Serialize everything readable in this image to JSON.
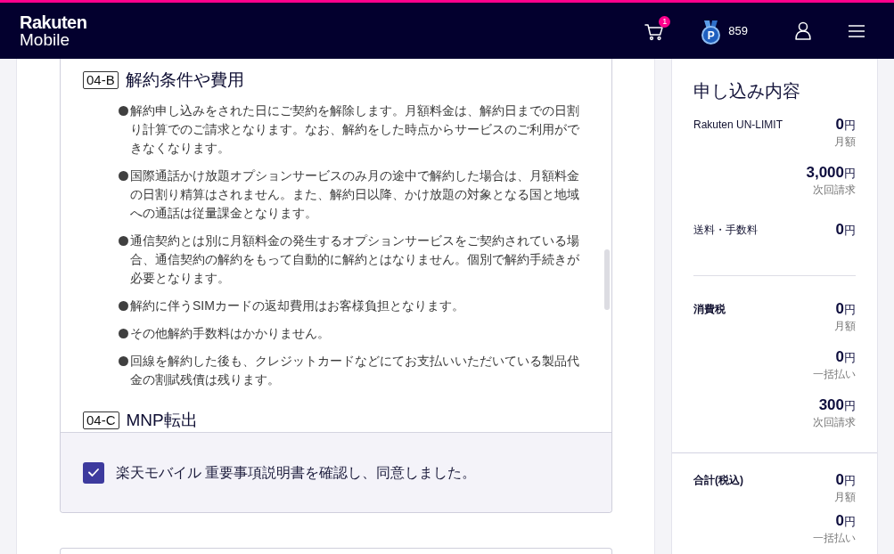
{
  "header": {
    "logo": {
      "line_1": "Rakuten",
      "line_2": "Mobile"
    },
    "cart": {
      "badge": "1"
    },
    "points": {
      "badge_letter": "P",
      "balance": "859"
    }
  },
  "terms": {
    "sections": [
      {
        "code": "04-B",
        "title": "解約条件や費用",
        "bullets": [
          "解約申し込みをされた日にご契約を解除します。月額料金は、解約日までの日割り計算でのご請求となります。なお、解約をした時点からサービスのご利用ができなくなります。",
          "国際通話かけ放題オプションサービスのみ月の途中で解約した場合は、月額料金の日割り精算はされません。また、解約日以降、かけ放題の対象となる国と地域への通話は従量課金となります。",
          "通信契約とは別に月額料金の発生するオプションサービスをご契約されている場合、通信契約の解約をもって自動的に解約とはなりません。個別で解約手続きが必要となります。",
          "解約に伴うSIMカードの返却費用はお客様負担となります。",
          "その他解約手数料はかかりません。",
          "回線を解約した後も、クレジットカードなどにてお支払いいただいている製品代金の割賦残債は残ります。"
        ]
      },
      {
        "code": "04-C",
        "title": "MNP転出"
      }
    ]
  },
  "agreement": {
    "checked": true,
    "label": "楽天モバイル 重要事項説明書を確認し、同意しました。"
  },
  "summary": {
    "sections": [
      {
        "title": "申し込み内容",
        "groups": [
          {
            "rows": [
              {
                "label": "Rakuten UN-LIMIT",
                "emphasized": false,
                "amounts": [
                  {
                    "price": "**0**円",
                    "note": "月額"
                  },
                  {
                    "price": "**3,000**円",
                    "note": "次回請求"
                  }
                ]
              },
              {
                "label": "送料・手数料",
                "emphasized": false,
                "amounts": [
                  {
                    "price": "**0**円"
                  }
                ]
              }
            ]
          },
          {
            "rows": [
              {
                "label": "消費税",
                "emphasized": true,
                "amounts": [
                  {
                    "price": "**0**円",
                    "note": "月額"
                  },
                  {
                    "price": "**0**円",
                    "note": "一括払い"
                  },
                  {
                    "price": "**300**円",
                    "note": "次回請求"
                  }
                ]
              }
            ]
          }
        ]
      },
      {
        "groups": [
          {
            "rows": [
              {
                "label": "合計(税込)",
                "emphasized": true,
                "amounts": [
                  {
                    "price": "**0**円",
                    "note": "月額"
                  },
                  {
                    "price": "**0**円",
                    "note": "一括払い"
                  }
                ]
              }
            ]
          }
        ]
      }
    ]
  }
}
